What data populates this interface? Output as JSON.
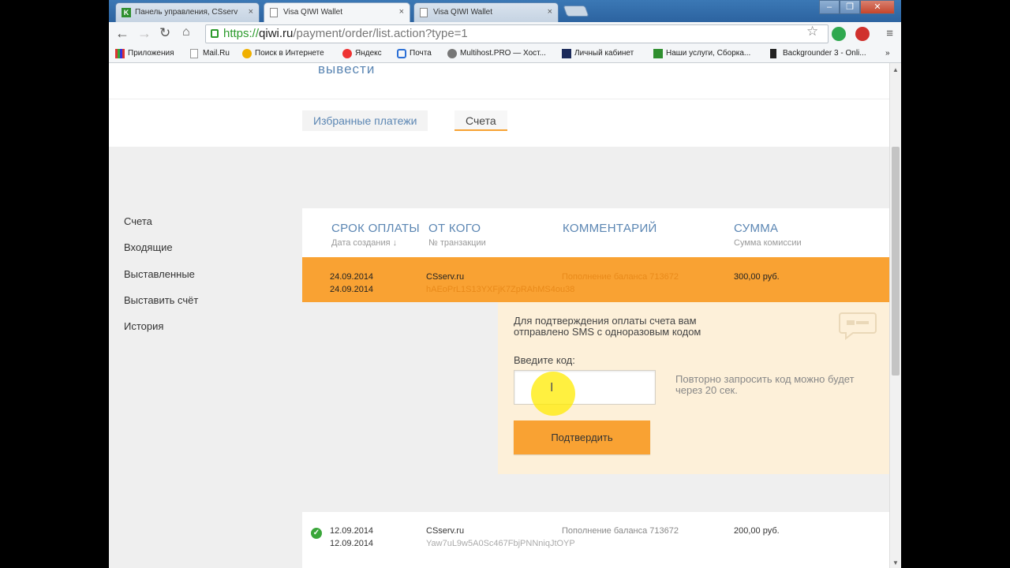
{
  "browser": {
    "tabs": [
      {
        "title": "Панель управления, CSserv",
        "favicon": "k-icon",
        "active": false
      },
      {
        "title": "Visa QIWI Wallet",
        "favicon": "doc-icon",
        "active": true
      },
      {
        "title": "Visa QIWI Wallet",
        "favicon": "doc-icon",
        "active": false
      }
    ],
    "url": {
      "scheme": "https://",
      "host": "qiwi.ru",
      "path": "/payment/order/list.action?type=1"
    },
    "bookmarks": [
      "Приложения",
      "Mail.Ru",
      "Поиск в Интернете",
      "Яндекс",
      "Почта",
      "Multihost.PRO — Хост...",
      "Личный кабинет",
      "Наши услуги, Сборка...",
      "Backgrounder 3 - Onli..."
    ]
  },
  "page": {
    "withdraw_link": "вывести",
    "tabs": [
      {
        "label": "Избранные платежи",
        "active": false
      },
      {
        "label": "Счета",
        "active": true
      }
    ],
    "sidebar": [
      "Счета",
      "Входящие",
      "Выставленные",
      "Выставить счёт",
      "История"
    ],
    "columns": [
      {
        "title": "СРОК ОПЛАТЫ",
        "sub": "Дата создания ↓"
      },
      {
        "title": "ОТ КОГО",
        "sub": "№ транзакции"
      },
      {
        "title": "КОММЕНТАРИЙ",
        "sub": ""
      },
      {
        "title": "СУММА",
        "sub": "Сумма комиссии"
      }
    ],
    "rows": [
      {
        "due": "24.09.2014",
        "created": "24.09.2014",
        "from": "CSserv.ru",
        "txn": "hAEoPrL1S13YXFjK7ZpRAhMS4ou38",
        "comment": "Пополнение баланса 713672",
        "amount": "300,00 руб.",
        "active": true
      },
      {
        "due": "12.09.2014",
        "created": "12.09.2014",
        "from": "CSserv.ru",
        "txn": "Yaw7uL9w5A0Sc467FbjPNNniqJtOYP",
        "comment": "Пополнение баланса 713672",
        "amount": "200,00 руб.",
        "status": "paid"
      }
    ],
    "confirm": {
      "message": "Для подтверждения оплаты счета вам отправлено SMS с одноразовым кодом",
      "code_label": "Введите код:",
      "code_value": "",
      "resend_hint": "Повторно запросить код можно будет через 20 сек.",
      "button": "Подтвердить"
    }
  },
  "colors": {
    "accent": "#f9a233",
    "link": "#5b86b3",
    "confirm_bg": "#fdf0d9"
  }
}
